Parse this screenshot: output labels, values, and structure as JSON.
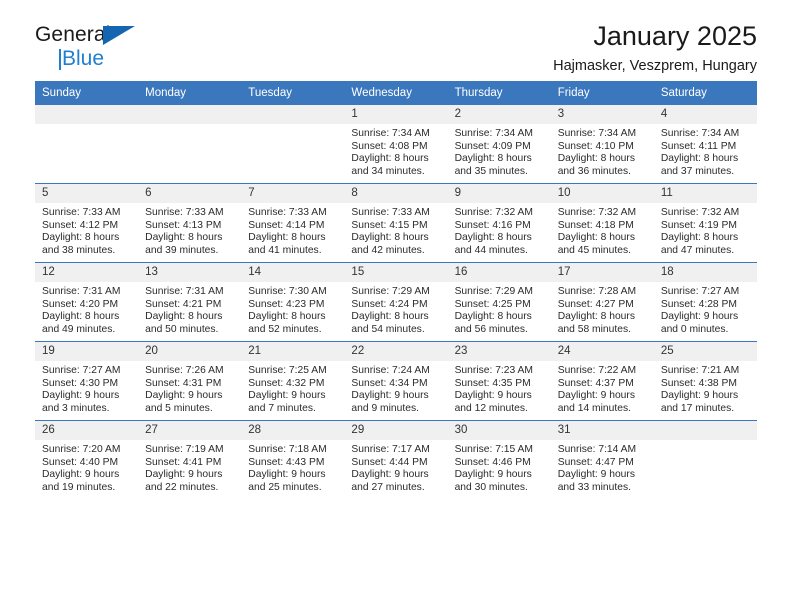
{
  "brand": {
    "line1": "General",
    "line2": "Blue",
    "triangle_color": "#1565b0",
    "blue_color": "#1f7fd0"
  },
  "header": {
    "title": "January 2025",
    "subtitle": "Hajmasker, Veszprem, Hungary",
    "header_bg": "#3b77bc",
    "daynum_bg": "#f0f0f0"
  },
  "weekday_headers": [
    "Sunday",
    "Monday",
    "Tuesday",
    "Wednesday",
    "Thursday",
    "Friday",
    "Saturday"
  ],
  "labels": {
    "sunrise_prefix": "Sunrise: ",
    "sunset_prefix": "Sunset: ",
    "daylight_prefix": "Daylight: "
  },
  "weeks": [
    [
      {
        "empty": true,
        "day": "",
        "sunrise": "",
        "sunset": "",
        "daylight_line1": "",
        "daylight_line2": ""
      },
      {
        "empty": true,
        "day": "",
        "sunrise": "",
        "sunset": "",
        "daylight_line1": "",
        "daylight_line2": ""
      },
      {
        "empty": true,
        "day": "",
        "sunrise": "",
        "sunset": "",
        "daylight_line1": "",
        "daylight_line2": ""
      },
      {
        "empty": false,
        "day": "1",
        "sunrise": "Sunrise: 7:34 AM",
        "sunset": "Sunset: 4:08 PM",
        "daylight_line1": "Daylight: 8 hours",
        "daylight_line2": "and 34 minutes."
      },
      {
        "empty": false,
        "day": "2",
        "sunrise": "Sunrise: 7:34 AM",
        "sunset": "Sunset: 4:09 PM",
        "daylight_line1": "Daylight: 8 hours",
        "daylight_line2": "and 35 minutes."
      },
      {
        "empty": false,
        "day": "3",
        "sunrise": "Sunrise: 7:34 AM",
        "sunset": "Sunset: 4:10 PM",
        "daylight_line1": "Daylight: 8 hours",
        "daylight_line2": "and 36 minutes."
      },
      {
        "empty": false,
        "day": "4",
        "sunrise": "Sunrise: 7:34 AM",
        "sunset": "Sunset: 4:11 PM",
        "daylight_line1": "Daylight: 8 hours",
        "daylight_line2": "and 37 minutes."
      }
    ],
    [
      {
        "empty": false,
        "day": "5",
        "sunrise": "Sunrise: 7:33 AM",
        "sunset": "Sunset: 4:12 PM",
        "daylight_line1": "Daylight: 8 hours",
        "daylight_line2": "and 38 minutes."
      },
      {
        "empty": false,
        "day": "6",
        "sunrise": "Sunrise: 7:33 AM",
        "sunset": "Sunset: 4:13 PM",
        "daylight_line1": "Daylight: 8 hours",
        "daylight_line2": "and 39 minutes."
      },
      {
        "empty": false,
        "day": "7",
        "sunrise": "Sunrise: 7:33 AM",
        "sunset": "Sunset: 4:14 PM",
        "daylight_line1": "Daylight: 8 hours",
        "daylight_line2": "and 41 minutes."
      },
      {
        "empty": false,
        "day": "8",
        "sunrise": "Sunrise: 7:33 AM",
        "sunset": "Sunset: 4:15 PM",
        "daylight_line1": "Daylight: 8 hours",
        "daylight_line2": "and 42 minutes."
      },
      {
        "empty": false,
        "day": "9",
        "sunrise": "Sunrise: 7:32 AM",
        "sunset": "Sunset: 4:16 PM",
        "daylight_line1": "Daylight: 8 hours",
        "daylight_line2": "and 44 minutes."
      },
      {
        "empty": false,
        "day": "10",
        "sunrise": "Sunrise: 7:32 AM",
        "sunset": "Sunset: 4:18 PM",
        "daylight_line1": "Daylight: 8 hours",
        "daylight_line2": "and 45 minutes."
      },
      {
        "empty": false,
        "day": "11",
        "sunrise": "Sunrise: 7:32 AM",
        "sunset": "Sunset: 4:19 PM",
        "daylight_line1": "Daylight: 8 hours",
        "daylight_line2": "and 47 minutes."
      }
    ],
    [
      {
        "empty": false,
        "day": "12",
        "sunrise": "Sunrise: 7:31 AM",
        "sunset": "Sunset: 4:20 PM",
        "daylight_line1": "Daylight: 8 hours",
        "daylight_line2": "and 49 minutes."
      },
      {
        "empty": false,
        "day": "13",
        "sunrise": "Sunrise: 7:31 AM",
        "sunset": "Sunset: 4:21 PM",
        "daylight_line1": "Daylight: 8 hours",
        "daylight_line2": "and 50 minutes."
      },
      {
        "empty": false,
        "day": "14",
        "sunrise": "Sunrise: 7:30 AM",
        "sunset": "Sunset: 4:23 PM",
        "daylight_line1": "Daylight: 8 hours",
        "daylight_line2": "and 52 minutes."
      },
      {
        "empty": false,
        "day": "15",
        "sunrise": "Sunrise: 7:29 AM",
        "sunset": "Sunset: 4:24 PM",
        "daylight_line1": "Daylight: 8 hours",
        "daylight_line2": "and 54 minutes."
      },
      {
        "empty": false,
        "day": "16",
        "sunrise": "Sunrise: 7:29 AM",
        "sunset": "Sunset: 4:25 PM",
        "daylight_line1": "Daylight: 8 hours",
        "daylight_line2": "and 56 minutes."
      },
      {
        "empty": false,
        "day": "17",
        "sunrise": "Sunrise: 7:28 AM",
        "sunset": "Sunset: 4:27 PM",
        "daylight_line1": "Daylight: 8 hours",
        "daylight_line2": "and 58 minutes."
      },
      {
        "empty": false,
        "day": "18",
        "sunrise": "Sunrise: 7:27 AM",
        "sunset": "Sunset: 4:28 PM",
        "daylight_line1": "Daylight: 9 hours",
        "daylight_line2": "and 0 minutes."
      }
    ],
    [
      {
        "empty": false,
        "day": "19",
        "sunrise": "Sunrise: 7:27 AM",
        "sunset": "Sunset: 4:30 PM",
        "daylight_line1": "Daylight: 9 hours",
        "daylight_line2": "and 3 minutes."
      },
      {
        "empty": false,
        "day": "20",
        "sunrise": "Sunrise: 7:26 AM",
        "sunset": "Sunset: 4:31 PM",
        "daylight_line1": "Daylight: 9 hours",
        "daylight_line2": "and 5 minutes."
      },
      {
        "empty": false,
        "day": "21",
        "sunrise": "Sunrise: 7:25 AM",
        "sunset": "Sunset: 4:32 PM",
        "daylight_line1": "Daylight: 9 hours",
        "daylight_line2": "and 7 minutes."
      },
      {
        "empty": false,
        "day": "22",
        "sunrise": "Sunrise: 7:24 AM",
        "sunset": "Sunset: 4:34 PM",
        "daylight_line1": "Daylight: 9 hours",
        "daylight_line2": "and 9 minutes."
      },
      {
        "empty": false,
        "day": "23",
        "sunrise": "Sunrise: 7:23 AM",
        "sunset": "Sunset: 4:35 PM",
        "daylight_line1": "Daylight: 9 hours",
        "daylight_line2": "and 12 minutes."
      },
      {
        "empty": false,
        "day": "24",
        "sunrise": "Sunrise: 7:22 AM",
        "sunset": "Sunset: 4:37 PM",
        "daylight_line1": "Daylight: 9 hours",
        "daylight_line2": "and 14 minutes."
      },
      {
        "empty": false,
        "day": "25",
        "sunrise": "Sunrise: 7:21 AM",
        "sunset": "Sunset: 4:38 PM",
        "daylight_line1": "Daylight: 9 hours",
        "daylight_line2": "and 17 minutes."
      }
    ],
    [
      {
        "empty": false,
        "day": "26",
        "sunrise": "Sunrise: 7:20 AM",
        "sunset": "Sunset: 4:40 PM",
        "daylight_line1": "Daylight: 9 hours",
        "daylight_line2": "and 19 minutes."
      },
      {
        "empty": false,
        "day": "27",
        "sunrise": "Sunrise: 7:19 AM",
        "sunset": "Sunset: 4:41 PM",
        "daylight_line1": "Daylight: 9 hours",
        "daylight_line2": "and 22 minutes."
      },
      {
        "empty": false,
        "day": "28",
        "sunrise": "Sunrise: 7:18 AM",
        "sunset": "Sunset: 4:43 PM",
        "daylight_line1": "Daylight: 9 hours",
        "daylight_line2": "and 25 minutes."
      },
      {
        "empty": false,
        "day": "29",
        "sunrise": "Sunrise: 7:17 AM",
        "sunset": "Sunset: 4:44 PM",
        "daylight_line1": "Daylight: 9 hours",
        "daylight_line2": "and 27 minutes."
      },
      {
        "empty": false,
        "day": "30",
        "sunrise": "Sunrise: 7:15 AM",
        "sunset": "Sunset: 4:46 PM",
        "daylight_line1": "Daylight: 9 hours",
        "daylight_line2": "and 30 minutes."
      },
      {
        "empty": false,
        "day": "31",
        "sunrise": "Sunrise: 7:14 AM",
        "sunset": "Sunset: 4:47 PM",
        "daylight_line1": "Daylight: 9 hours",
        "daylight_line2": "and 33 minutes."
      },
      {
        "empty": true,
        "day": "",
        "sunrise": "",
        "sunset": "",
        "daylight_line1": "",
        "daylight_line2": ""
      }
    ]
  ]
}
